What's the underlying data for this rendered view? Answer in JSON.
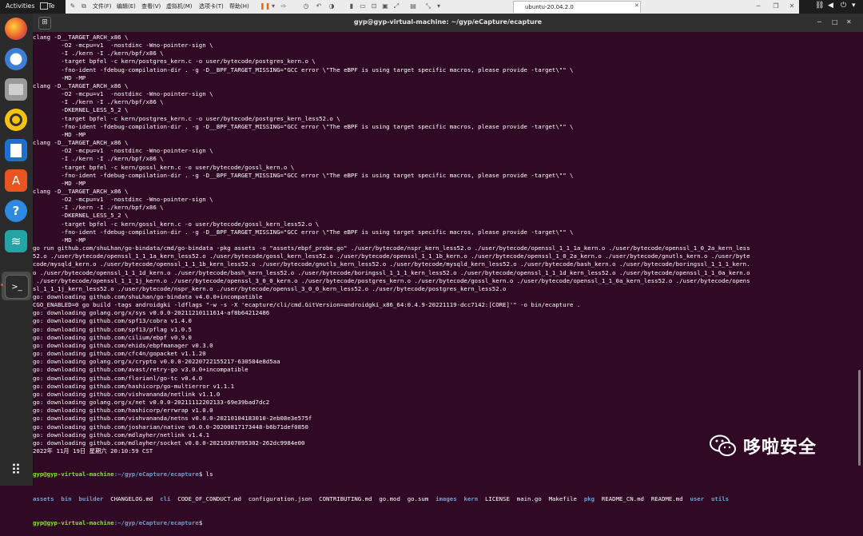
{
  "topbar": {
    "activities": "Activities",
    "te_label": "Te",
    "vm_menu": [
      "文件(F)",
      "编辑(E)",
      "查看(V)",
      "虚拟机(M)",
      "选项卡(T)",
      "帮助(H)"
    ],
    "vm_tab": "ubuntu-20.04.2.0"
  },
  "terminal": {
    "title": "gyp@gyp-virtual-machine: ~/gyp/eCapture/ecapture",
    "output_lines": [
      "clang -D__TARGET_ARCH_x86 \\",
      "        -O2 -mcpu=v1  -nostdinc -Wno-pointer-sign \\",
      "        -I ./kern -I ./kern/bpf/x86 \\",
      "        -target bpfel -c kern/postgres_kern.c -o user/bytecode/postgres_kern.o \\",
      "        -fno-ident -fdebug-compilation-dir . -g -D__BPF_TARGET_MISSING=\"GCC error \\\"The eBPF is using target specific macros, please provide -target\\\"\" \\",
      "        -MD -MP",
      "clang -D__TARGET_ARCH_x86 \\",
      "        -O2 -mcpu=v1  -nostdinc -Wno-pointer-sign \\",
      "        -I ./kern -I ./kern/bpf/x86 \\",
      "        -DKERNEL_LESS_5_2 \\",
      "        -target bpfel -c kern/postgres_kern.c -o user/bytecode/postgres_kern_less52.o \\",
      "        -fno-ident -fdebug-compilation-dir . -g -D__BPF_TARGET_MISSING=\"GCC error \\\"The eBPF is using target specific macros, please provide -target\\\"\" \\",
      "        -MD -MP",
      "clang -D__TARGET_ARCH_x86 \\",
      "        -O2 -mcpu=v1  -nostdinc -Wno-pointer-sign \\",
      "        -I ./kern -I ./kern/bpf/x86 \\",
      "        -target bpfel -c kern/gossl_kern.c -o user/bytecode/gossl_kern.o \\",
      "        -fno-ident -fdebug-compilation-dir . -g -D__BPF_TARGET_MISSING=\"GCC error \\\"The eBPF is using target specific macros, please provide -target\\\"\" \\",
      "        -MD -MP",
      "clang -D__TARGET_ARCH_x86 \\",
      "        -O2 -mcpu=v1  -nostdinc -Wno-pointer-sign \\",
      "        -I ./kern -I ./kern/bpf/x86 \\",
      "        -DKERNEL_LESS_5_2 \\",
      "        -target bpfel -c kern/gossl_kern.c -o user/bytecode/gossl_kern_less52.o \\",
      "        -fno-ident -fdebug-compilation-dir . -g -D__BPF_TARGET_MISSING=\"GCC error \\\"The eBPF is using target specific macros, please provide -target\\\"\" \\",
      "        -MD -MP",
      "go run github.com/shuLhan/go-bindata/cmd/go-bindata -pkg assets -o \"assets/ebpf_probe.go\" ./user/bytecode/nspr_kern_less52.o ./user/bytecode/openssl_1_1_1a_kern.o ./user/bytecode/openssl_1_0_2a_kern_less",
      "52.o ./user/bytecode/openssl_1_1_1a_kern_less52.o ./user/bytecode/gossl_kern_less52.o ./user/bytecode/openssl_1_1_1b_kern.o ./user/bytecode/openssl_1_0_2a_kern.o ./user/bytecode/gnutls_kern.o ./user/byte",
      "code/mysqld_kern.o ./user/bytecode/openssl_1_1_1b_kern_less52.o ./user/bytecode/gnutls_kern_less52.o ./user/bytecode/mysqld_kern_less52.o ./user/bytecode/bash_kern.o ./user/bytecode/boringssl_1_1_1_kern.",
      "o ./user/bytecode/openssl_1_1_1d_kern.o ./user/bytecode/bash_kern_less52.o ./user/bytecode/boringssl_1_1_1_kern_less52.o ./user/bytecode/openssl_1_1_1d_kern_less52.o ./user/bytecode/openssl_1_1_0a_kern.o",
      " ./user/bytecode/openssl_1_1_1j_kern.o ./user/bytecode/openssl_3_0_0_kern.o ./user/bytecode/postgres_kern.o ./user/bytecode/gossl_kern.o ./user/bytecode/openssl_1_1_0a_kern_less52.o ./user/bytecode/opens",
      "sl_1_1_1j_kern_less52.o ./user/bytecode/nspr_kern.o ./user/bytecode/openssl_3_0_0_kern_less52.o ./user/bytecode/postgres_kern_less52.o",
      "go: downloading github.com/shuLhan/go-bindata v4.0.0+incompatible",
      "CGO_ENABLED=0 go build -tags androidgki -ldflags \"-w -s -X 'ecapture/cli/cmd.GitVersion=androidgki_x86_64:0.4.9-20221119-dcc7142:[CORE]'\" -o bin/ecapture .",
      "go: downloading golang.org/x/sys v0.0.0-20211210111614-af8b64212486",
      "go: downloading github.com/spf13/cobra v1.4.0",
      "go: downloading github.com/spf13/pflag v1.0.5",
      "go: downloading github.com/cilium/ebpf v0.9.0",
      "go: downloading github.com/ehids/ebpfmanager v0.3.0",
      "go: downloading github.com/cfc4n/gopacket v1.1.20",
      "go: downloading golang.org/x/crypto v0.0.0-20220722155217-630584e8d5aa",
      "go: downloading github.com/avast/retry-go v3.0.0+incompatible",
      "go: downloading github.com/florianl/go-tc v0.4.0",
      "go: downloading github.com/hashicorp/go-multierror v1.1.1",
      "go: downloading github.com/vishvananda/netlink v1.1.0",
      "go: downloading golang.org/x/net v0.0.0-20211112202133-69e39bad7dc2",
      "go: downloading github.com/hashicorp/errwrap v1.0.0",
      "go: downloading github.com/vishvananda/netns v0.0.0-20210104183010-2eb08e3e575f",
      "go: downloading github.com/josharian/native v0.0.0-20200817173448-b6b71def0850",
      "go: downloading github.com/mdlayher/netlink v1.4.1",
      "go: downloading github.com/mdlayher/socket v0.0.0-20210307095302-262dc9984e00",
      "2022年 11月 19日 星期六 20:10:59 CST"
    ],
    "prompt_user": "gyp@gyp-virtual-machine",
    "prompt_path": ":~/gyp/eCapture/ecapture",
    "prompt_sym": "$ ",
    "command": "ls",
    "ls_entries": [
      {
        "name": "assets",
        "dir": true
      },
      {
        "name": "bin",
        "dir": true
      },
      {
        "name": "builder",
        "dir": true
      },
      {
        "name": "CHANGELOG.md",
        "dir": false
      },
      {
        "name": "cli",
        "dir": true
      },
      {
        "name": "CODE_OF_CONDUCT.md",
        "dir": false
      },
      {
        "name": "configuration.json",
        "dir": false
      },
      {
        "name": "CONTRIBUTING.md",
        "dir": false
      },
      {
        "name": "go.mod",
        "dir": false
      },
      {
        "name": "go.sum",
        "dir": false
      },
      {
        "name": "images",
        "dir": true
      },
      {
        "name": "kern",
        "dir": true
      },
      {
        "name": "LICENSE",
        "dir": false
      },
      {
        "name": "main.go",
        "dir": false
      },
      {
        "name": "Makefile",
        "dir": false
      },
      {
        "name": "pkg",
        "dir": true
      },
      {
        "name": "README_CN.md",
        "dir": false
      },
      {
        "name": "README.md",
        "dir": false
      },
      {
        "name": "user",
        "dir": true
      },
      {
        "name": "utils",
        "dir": true
      }
    ]
  },
  "watermark": {
    "text": "哆啦安全"
  },
  "colors": {
    "terminal_bg": "#300a24",
    "prompt_user": "#8ae234",
    "prompt_path": "#729fcf",
    "accent": "#e95420"
  }
}
